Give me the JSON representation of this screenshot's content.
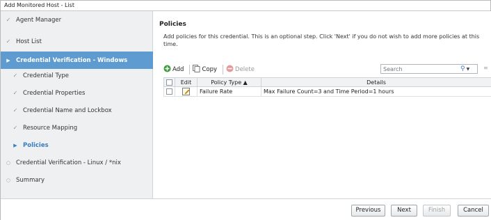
{
  "window": {
    "title": "Add Monitored Host - List"
  },
  "sidebar": {
    "items": [
      {
        "label": "Agent Manager",
        "state": "done"
      },
      {
        "label": "Host List",
        "state": "done"
      },
      {
        "label": "Credential Verification - Windows",
        "state": "active"
      },
      {
        "label": "Credential Type",
        "state": "done"
      },
      {
        "label": "Credential Properties",
        "state": "done"
      },
      {
        "label": "Credential Name and Lockbox",
        "state": "done"
      },
      {
        "label": "Resource Mapping",
        "state": "done"
      },
      {
        "label": "Policies",
        "state": "current"
      },
      {
        "label": "Credential Verification - Linux / *nix",
        "state": "pending"
      },
      {
        "label": "Summary",
        "state": "pending"
      }
    ]
  },
  "main": {
    "title": "Policies",
    "description": "Add policies for this credential. This is an optional step. Click 'Next' if you do not wish to add more policies at this time."
  },
  "toolbar": {
    "add_label": "Add",
    "copy_label": "Copy",
    "delete_label": "Delete",
    "search_placeholder": "Search"
  },
  "table": {
    "headers": {
      "edit": "Edit",
      "policy_type": "Policy Type ▲",
      "details": "Details"
    },
    "rows": [
      {
        "policy_type": "Failure Rate",
        "details": "Max Failure Count=3 and Time Period=1 hours"
      }
    ]
  },
  "footer": {
    "previous_label": "Previous",
    "next_label": "Next",
    "finish_label": "Finish",
    "cancel_label": "Cancel"
  },
  "colors": {
    "active_bg": "#5e9bd1",
    "accent": "#3a7cc0",
    "add_icon": "#3a9a3a",
    "delete_icon": "#e39a9a"
  }
}
